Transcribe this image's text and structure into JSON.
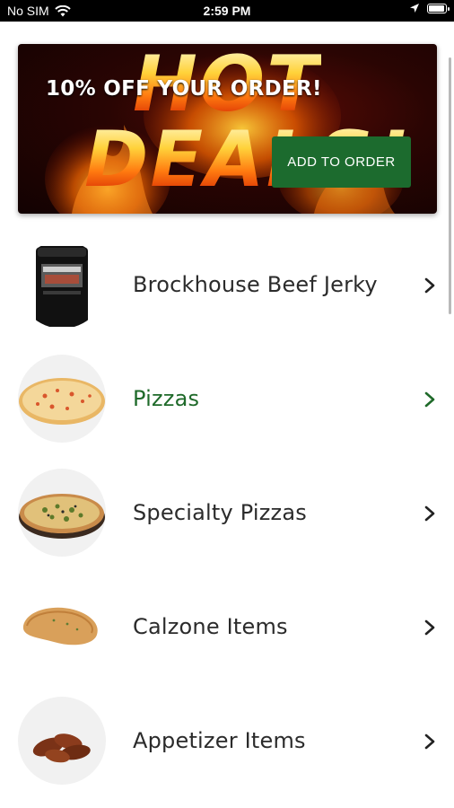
{
  "status_bar": {
    "carrier": "No SIM",
    "time": "2:59 PM",
    "battery_level": 0.85
  },
  "promo": {
    "headline": "10% OFF YOUR ORDER!",
    "title_line1": "HOT",
    "title_line2": "DEALS!",
    "cta_label": "ADD TO ORDER",
    "accent_color": "#1c6b2e"
  },
  "menu": {
    "active_color": "#1f6a2a",
    "items": [
      {
        "label": "Brockhouse Beef Jerky",
        "icon": "jerky-bag-image",
        "active": false
      },
      {
        "label": "Pizzas",
        "icon": "pizza-image",
        "active": true
      },
      {
        "label": "Specialty Pizzas",
        "icon": "specialty-pizza-image",
        "active": false
      },
      {
        "label": "Calzone Items",
        "icon": "calzone-image",
        "active": false
      },
      {
        "label": "Appetizer Items",
        "icon": "wings-image",
        "active": false
      }
    ]
  }
}
